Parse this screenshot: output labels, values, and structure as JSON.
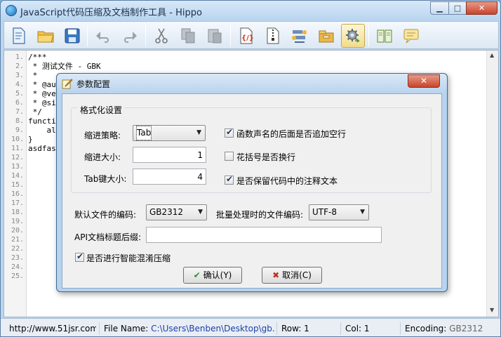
{
  "window": {
    "title": "JavaScript代码压缩及文档制作工具 - Hippo",
    "minimize": "▁",
    "maximize": "□",
    "close": "✕"
  },
  "toolbar": {
    "icons": [
      "new-document-icon",
      "open-folder-icon",
      "save-icon",
      "undo-icon",
      "redo-icon",
      "cut-icon",
      "copy-icon",
      "paste-icon",
      "compress-js-icon",
      "zip-file-icon",
      "tools-icon",
      "folder-box-icon",
      "settings-gear-icon",
      "book-icon",
      "message-icon"
    ]
  },
  "editor": {
    "line_numbers": [
      "1.",
      "2.",
      "3.",
      "4.",
      "5.",
      "6.",
      "7.",
      "8.",
      "9.",
      "10.",
      "11.",
      "12.",
      "13.",
      "14.",
      "15.",
      "16.",
      "17.",
      "18.",
      "19.",
      "20.",
      "21.",
      "22.",
      "23.",
      "24.",
      "25."
    ],
    "lines": [
      "/***",
      " * 测试文件 - GBK",
      " *",
      " * @aut",
      " * @ver",
      " * @sin",
      " */",
      "functio",
      "    al",
      "}",
      "asdfasd",
      "",
      "",
      "",
      "",
      "",
      "",
      "",
      "",
      "",
      "",
      "",
      "",
      "",
      ""
    ]
  },
  "statusbar": {
    "website": "http://www.51jsr.com",
    "filename_label": "File Name:",
    "filename": "C:\\Users\\Benben\\Desktop\\gb.js",
    "row": "Row: 1",
    "col": "Col: 1",
    "encoding_label": "Encoding:",
    "encoding": "GB2312"
  },
  "dialog": {
    "title": "参数配置",
    "close": "✕",
    "format_group": "格式化设置",
    "indent_strategy_label": "缩进策略:",
    "indent_strategy_value": "Tab",
    "indent_size_label": "缩进大小:",
    "indent_size_value": "1",
    "tab_size_label": "Tab键大小:",
    "tab_size_value": "4",
    "cb_func_space": {
      "label": "函数声名的后面是否追加空行",
      "checked": true
    },
    "cb_brace_newline": {
      "label": "花括号是否换行",
      "checked": false
    },
    "cb_keep_comments": {
      "label": "是否保留代码中的注释文本",
      "checked": true
    },
    "default_encoding_label": "默认文件的编码:",
    "default_encoding_value": "GB2312",
    "batch_encoding_label": "批量处理时的文件编码:",
    "batch_encoding_value": "UTF-8",
    "api_suffix_label": "API文档标题后缀:",
    "api_suffix_value": "",
    "cb_smart_obfuscate": {
      "label": "是否进行智能混淆压缩",
      "checked": true
    },
    "ok_button": "确认(Y)",
    "cancel_button": "取消(C)"
  }
}
